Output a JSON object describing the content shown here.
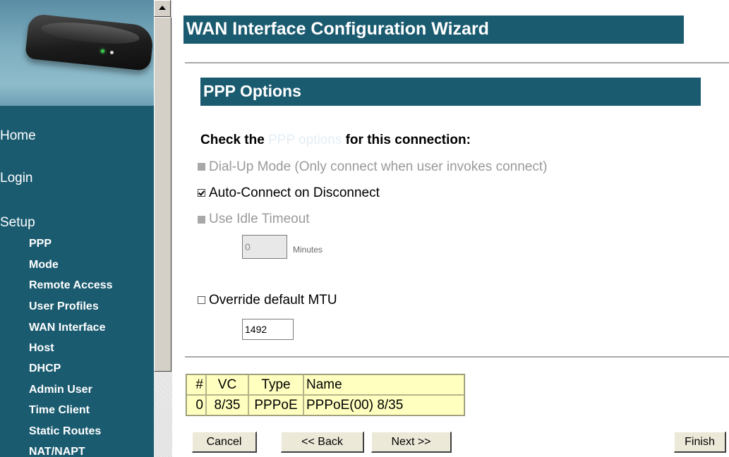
{
  "sidebar": {
    "nav_main": [
      "Home",
      "Login",
      "Setup"
    ],
    "nav_sub": [
      "PPP",
      "Mode",
      "Remote Access",
      "User Profiles",
      "WAN Interface",
      "Host",
      "DHCP",
      "Admin User",
      "Time Client",
      "Static Routes",
      "NAT/NAPT"
    ]
  },
  "main": {
    "title": "WAN Interface Configuration Wizard",
    "section_title": "PPP Options",
    "prompt_before": "Check the ",
    "prompt_highlight": "PPP options",
    "prompt_after": " for this connection:"
  },
  "options": {
    "dialup_label": "Dial-Up Mode (Only connect when user invokes connect)",
    "autoconnect_label": "Auto-Connect on Disconnect",
    "idle_label": "Use Idle Timeout",
    "idle_value": "0",
    "idle_unit": "Minutes",
    "mtu_label": "Override default MTU",
    "mtu_value": "1492"
  },
  "table": {
    "headers": [
      "#",
      "VC",
      "Type",
      "Name"
    ],
    "row": [
      "0",
      "8/35",
      "PPPoE",
      "PPPoE(00) 8/35"
    ]
  },
  "buttons": {
    "cancel": "Cancel",
    "back": "<< Back",
    "next": "Next >>",
    "finish": "Finish"
  },
  "colors": {
    "banner": "#1a5b70",
    "table_bg": "#ffffc0",
    "disabled_text": "#9a9a9a"
  }
}
